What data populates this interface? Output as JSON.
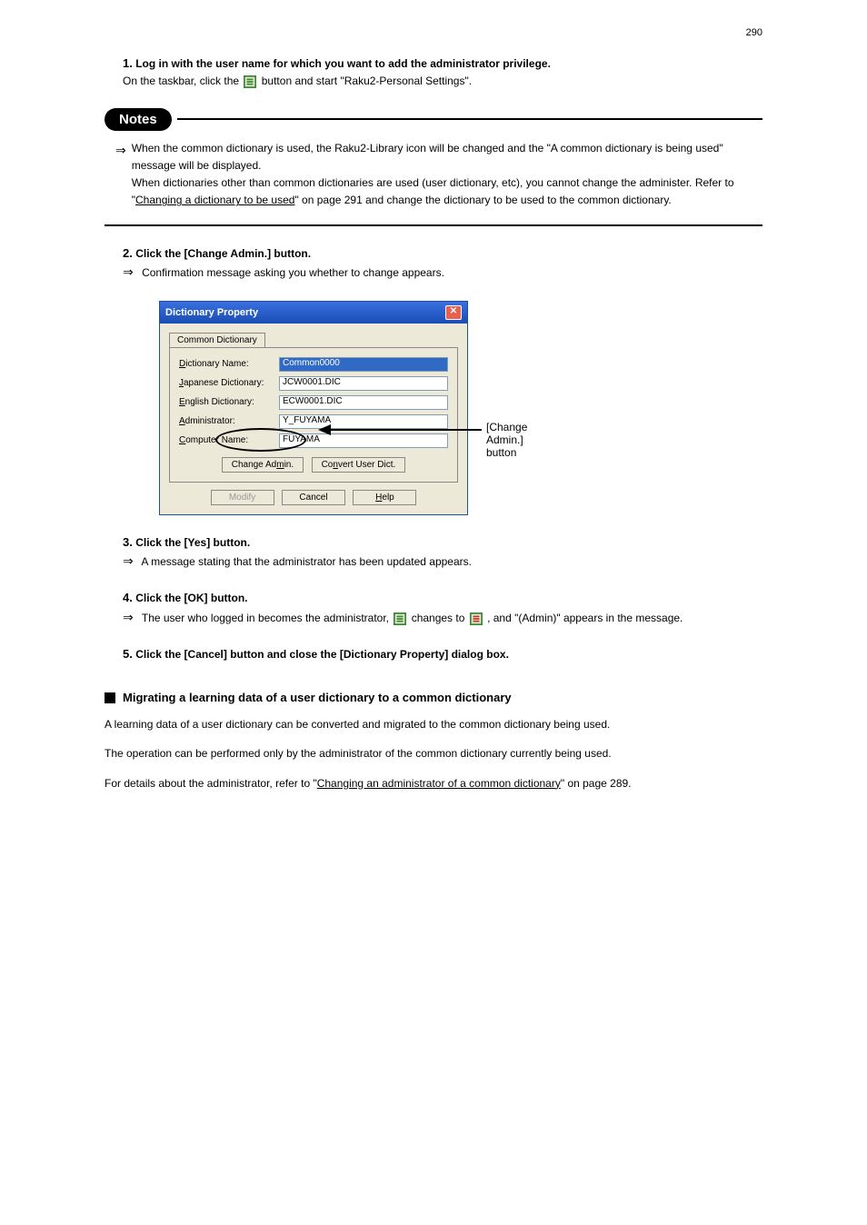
{
  "page_number": "290",
  "step1": {
    "num": "1.",
    "title": "Log in with the user name for which you want to add the administrator privilege.",
    "line1_a": "On the taskbar, click the ",
    "line1_b": " button and start \"Raku2-Personal Settings\"."
  },
  "notes": {
    "label": "Notes",
    "arrow": "⇒",
    "line1": "When the common dictionary is used, the Raku2-Library icon will be changed and the \"A common dictionary is being used\" message will be displayed.",
    "line2a": "When dictionaries other than common dictionaries are used (user dictionary, etc), you cannot change the administer. Refer to \"",
    "line2_link": "Changing a dictionary to be used",
    "line2b": "\" on page 291 and change the dictionary to be used to the common dictionary."
  },
  "step2": {
    "num": "2.",
    "title": "Click the [Change Admin.] button.",
    "result": "Confirmation message asking you whether to change appears."
  },
  "dialog": {
    "title": "Dictionary Property",
    "tab": "Common Dictionary",
    "labels": {
      "dict_name": "Dictionary Name:",
      "jp_dict": "Japanese Dictionary:",
      "en_dict": "English Dictionary:",
      "admin": "Administrator:",
      "comp": "Computer Name:"
    },
    "values": {
      "dict_name": "Common0000",
      "jp_dict": "JCW0001.DIC",
      "en_dict": "ECW0001.DIC",
      "admin": "Y_FUYAMA",
      "comp": "FUYAMA"
    },
    "buttons": {
      "change_admin": "Change Admin.",
      "convert": "Convert User Dict.",
      "modify": "Modify",
      "cancel": "Cancel",
      "help": "Help"
    }
  },
  "callout_label": "[Change Admin.] button",
  "step3": {
    "num": "3.",
    "title": "Click the [Yes] button.",
    "result": "A message stating that the administrator has been updated appears."
  },
  "step4": {
    "num": "4.",
    "title": "Click the [OK] button.",
    "line1a": "The user who logged in becomes the administrator, ",
    "line1b": " changes to ",
    "line1c": " , and \"(Admin)\" appears in the message."
  },
  "step5": {
    "num": "5.",
    "title": "Click the [Cancel] button and close the [Dictionary Property] dialog box."
  },
  "section": {
    "header": "Migrating a learning data of a user dictionary to a common dictionary",
    "p1": "A learning data of a user dictionary can be converted and migrated to the common dictionary being used.",
    "p2": "The operation can be performed only by the administrator of the common dictionary currently being used.",
    "p3a": "For details about the administrator, refer to \"",
    "p3_link": "Changing an administrator of a common dictionary",
    "p3b": "\" on page 289."
  }
}
